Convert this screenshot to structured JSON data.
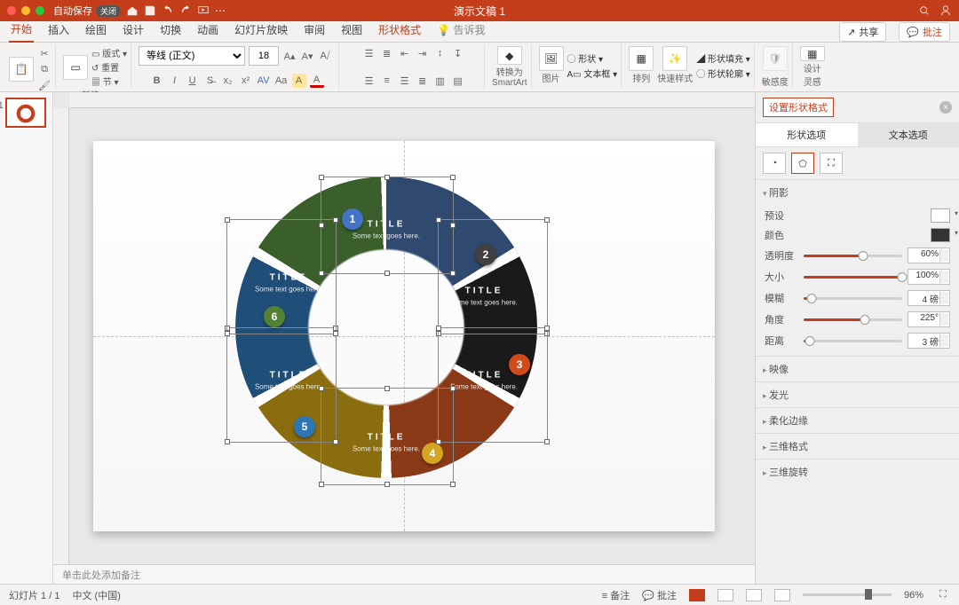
{
  "titlebar": {
    "autosave": "自动保存",
    "autosave_state": "关闭",
    "title": "演示文稿 1"
  },
  "tabs": {
    "items": [
      "开始",
      "插入",
      "绘图",
      "设计",
      "切换",
      "动画",
      "幻灯片放映",
      "审阅",
      "视图",
      "形状格式"
    ],
    "tellme": "告诉我",
    "share": "共享",
    "comments": "批注"
  },
  "ribbon": {
    "paste": "粘贴",
    "newslide": "新建\n幻灯片",
    "layout": "版式",
    "reset": "重置",
    "section": "节",
    "font_name": "等线 (正文)",
    "font_size": "18",
    "convert": "转换为\nSmartArt",
    "picture": "图片",
    "shapes": "形状",
    "textbox": "文本框",
    "arrange": "排列",
    "quickstyle": "快速样式",
    "shapefill": "形状填充",
    "shapeoutline": "形状轮廓",
    "sensitivity": "敏感度",
    "designer": "设计\n灵感"
  },
  "thumbs": {
    "num": "1"
  },
  "slide": {
    "segments": [
      {
        "title": "TITLE",
        "sub": "Some text goes here.",
        "num": "1",
        "color": "#2f4a6e",
        "badge": "#4472c4"
      },
      {
        "title": "TITLE",
        "sub": "Some text goes here.",
        "num": "2",
        "color": "#1a1a1a",
        "badge": "#404040"
      },
      {
        "title": "TITLE",
        "sub": "Some text goes here.",
        "num": "3",
        "color": "#8b3a18",
        "badge": "#d04a1a"
      },
      {
        "title": "TITLE",
        "sub": "Some text goes here.",
        "num": "4",
        "color": "#8a6d0f",
        "badge": "#d4a520"
      },
      {
        "title": "TITLE",
        "sub": "Some text goes here.",
        "num": "5",
        "color": "#1f4e79",
        "badge": "#2e75b6"
      },
      {
        "title": "TITLE",
        "sub": "Some text goes here.",
        "num": "6",
        "color": "#3a5f2a",
        "badge": "#548235"
      }
    ]
  },
  "notes": {
    "placeholder": "单击此处添加备注"
  },
  "pane": {
    "title": "设置形状格式",
    "subtabs": {
      "shape": "形状选项",
      "text": "文本选项"
    },
    "section_shadow": "阴影",
    "preset": "预设",
    "color": "颜色",
    "transparency": {
      "label": "透明度",
      "val": "60%",
      "pct": 60
    },
    "size": {
      "label": "大小",
      "val": "100%",
      "pct": 100
    },
    "blur": {
      "label": "模糊",
      "val": "4 磅",
      "pct": 8
    },
    "angle": {
      "label": "角度",
      "val": "225°",
      "pct": 62
    },
    "distance": {
      "label": "距离",
      "val": "3 磅",
      "pct": 6
    },
    "others": [
      "映像",
      "发光",
      "柔化边缘",
      "三维格式",
      "三维旋转"
    ]
  },
  "status": {
    "slide": "幻灯片 1 / 1",
    "lang": "中文 (中国)",
    "notes": "备注",
    "comments": "批注",
    "zoom": "96%"
  }
}
